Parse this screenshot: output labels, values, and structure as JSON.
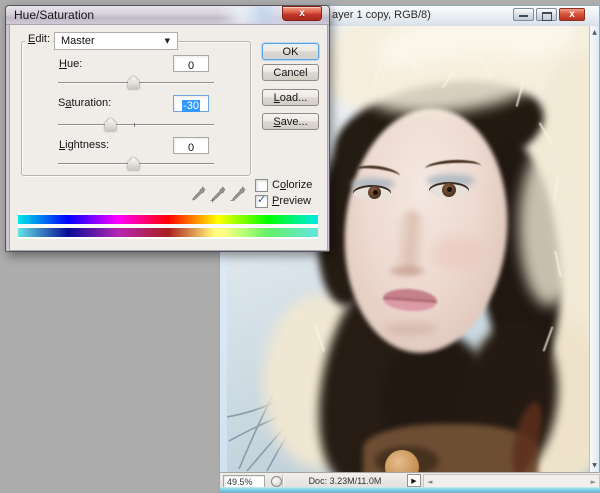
{
  "colors": {
    "workspace": "#acacac",
    "selection_blue": "#3399ff",
    "close_button_red": "#c13527",
    "dialog_frame": "#cbc4d2",
    "window_edge_cyan": "#5fc0d8"
  },
  "dialog": {
    "title": "Hue/Saturation",
    "close": "x",
    "edit": {
      "pre": "",
      "key": "E",
      "post": "dit:",
      "value": "Master",
      "arrow": "▼"
    },
    "rows": [
      {
        "pre": "",
        "key": "H",
        "post": "ue:",
        "value": "0"
      },
      {
        "pre": "S",
        "key": "a",
        "post": "turation:",
        "value": "-30"
      },
      {
        "pre": "",
        "key": "L",
        "post": "ightness:",
        "value": "0"
      }
    ],
    "buttons": {
      "ok": "OK",
      "cancel": "Cancel",
      "load": {
        "pre": "",
        "key": "L",
        "post": "oad..."
      },
      "save": {
        "pre": "",
        "key": "S",
        "post": "ave..."
      }
    },
    "checks": {
      "colorize": {
        "pre": "C",
        "key": "o",
        "post": "lorize",
        "checked": false
      },
      "preview": {
        "pre": "",
        "key": "P",
        "post": "review",
        "checked": true
      },
      "checkmark": "✓"
    },
    "eyedroppers": [
      "eyedropper",
      "eyedropper-plus",
      "eyedropper-minus"
    ]
  },
  "docwin": {
    "title": "ayer 1 copy, RGB/8)",
    "status": {
      "zoom": "49.5%",
      "doc": "Doc: 3.23M/11.0M"
    },
    "glyphs": {
      "panel": "▶",
      "left": "◄",
      "right": "►",
      "up": "▲",
      "down": "▼"
    }
  }
}
